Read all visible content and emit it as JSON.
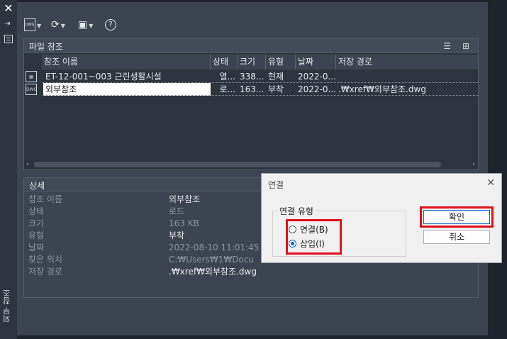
{
  "toolbar": {
    "attach_label": "DWG",
    "refresh_label": "⟳",
    "change_label": "▣",
    "help_label": "?"
  },
  "file_refs": {
    "section_title": "파일 참조",
    "columns": [
      "참조 이름",
      "상태",
      "크기",
      "유형",
      "날짜",
      "저장 경로"
    ],
    "rows": [
      {
        "name": "ET-12-001~003 근린생활시설",
        "status": "열...",
        "size": "338...",
        "type": "현재",
        "date": "2022-0...",
        "path": ""
      },
      {
        "name": "외부참조",
        "status": "로...",
        "size": "163...",
        "type": "부착",
        "date": "2022-0...",
        "path": ".₩xref₩외부참조.dwg"
      }
    ]
  },
  "details": {
    "section_title": "상세",
    "rows": [
      {
        "key": "참조 이름",
        "value": "외부참조"
      },
      {
        "key": "상태",
        "value": "로드"
      },
      {
        "key": "크기",
        "value": "163 KB"
      },
      {
        "key": "유형",
        "value": "부착"
      },
      {
        "key": "날짜",
        "value": "2022-08-10 11:01:45"
      },
      {
        "key": "찾은 위치",
        "value": "C:₩Users₩1₩Docu"
      },
      {
        "key": "저장 경로",
        "value": ".₩xref₩외부참조.dwg"
      }
    ]
  },
  "palette_vertical_title": "외부 참조",
  "dialog": {
    "title": "연결",
    "group_label": "연결 유형",
    "options": [
      {
        "label": "연결(B)",
        "selected": false
      },
      {
        "label": "삽입(I)",
        "selected": true
      }
    ],
    "ok_label": "확인",
    "cancel_label": "취소"
  },
  "colors": {
    "highlight": "#e0101a",
    "radio_selected": "#0a64c8"
  }
}
